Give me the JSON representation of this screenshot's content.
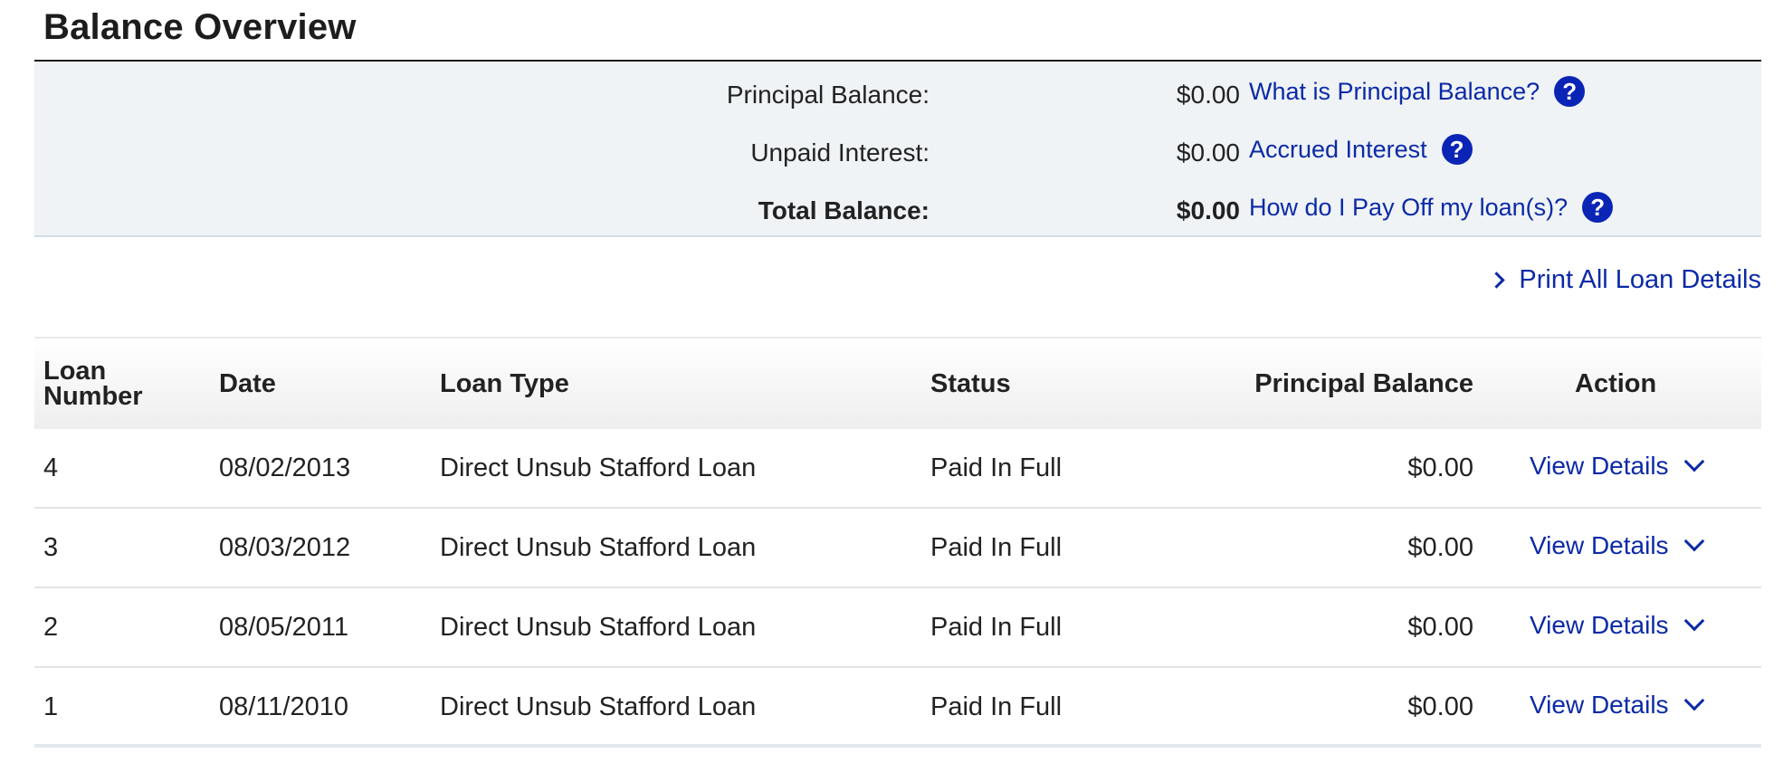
{
  "page_title": "Balance Overview",
  "summary": {
    "rows": [
      {
        "label": "Principal Balance:",
        "value": "$0.00",
        "link": "What is Principal Balance?",
        "icon": "help-icon"
      },
      {
        "label": "Unpaid Interest:",
        "value": "$0.00",
        "link": "Accrued Interest",
        "icon": "help-icon"
      },
      {
        "label": "Total Balance:",
        "value": "$0.00",
        "link": "How do I Pay Off my loan(s)?",
        "icon": "help-icon"
      }
    ]
  },
  "print_link": {
    "label": "Print All Loan Details",
    "icon": "chevron-right-icon"
  },
  "table": {
    "headers": {
      "loan_number_line1": "Loan",
      "loan_number_line2": "Number",
      "date": "Date",
      "loan_type": "Loan Type",
      "status": "Status",
      "principal_balance": "Principal Balance",
      "action": "Action"
    },
    "rows": [
      {
        "loan_number": "4",
        "date": "08/02/2013",
        "loan_type": "Direct Unsub Stafford Loan",
        "status": "Paid In Full",
        "principal_balance": "$0.00",
        "action": "View Details"
      },
      {
        "loan_number": "3",
        "date": "08/03/2012",
        "loan_type": "Direct Unsub Stafford Loan",
        "status": "Paid In Full",
        "principal_balance": "$0.00",
        "action": "View Details"
      },
      {
        "loan_number": "2",
        "date": "08/05/2011",
        "loan_type": "Direct Unsub Stafford Loan",
        "status": "Paid In Full",
        "principal_balance": "$0.00",
        "action": "View Details"
      },
      {
        "loan_number": "1",
        "date": "08/11/2010",
        "loan_type": "Direct Unsub Stafford Loan",
        "status": "Paid In Full",
        "principal_balance": "$0.00",
        "action": "View Details"
      }
    ]
  },
  "colors": {
    "link": "#0b2aa6",
    "help_icon_bg": "#0a25b5",
    "summary_bg": "#eff3f6"
  }
}
